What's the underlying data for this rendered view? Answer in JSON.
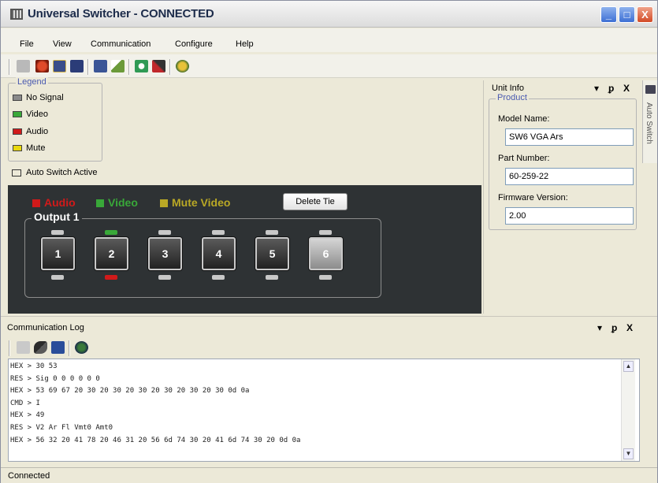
{
  "window": {
    "title": "Universal Switcher - CONNECTED",
    "min": "_",
    "max": "□",
    "close": "X"
  },
  "menu": [
    "File",
    "View",
    "Communication",
    "Configure",
    "Help"
  ],
  "toolbar_icons": [
    "disconnect-icon",
    "connect-icon",
    "view-matrix-icon",
    "view-list-icon",
    "display-icon",
    "edit-icon",
    "refresh-icon",
    "tools-icon",
    "help-icon"
  ],
  "legend": {
    "title": "Legend",
    "items": [
      {
        "label": "No Signal",
        "color": "#8a8a8a"
      },
      {
        "label": "Video",
        "color": "#39a839"
      },
      {
        "label": "Audio",
        "color": "#d11a1a"
      },
      {
        "label": "Mute",
        "color": "#e9d80c"
      }
    ]
  },
  "auto_switch": "Auto Switch Active",
  "tie_tags": {
    "audio": "Audio",
    "video": "Video",
    "mute": "Mute Video"
  },
  "tie_colors": {
    "audio": "#d11a1a",
    "video": "#39a839",
    "mute": "#b9a825"
  },
  "delete_tie": "Delete Tie",
  "output": {
    "title": "Output 1",
    "buttons": [
      {
        "label": "1",
        "top_led": "off",
        "bottom_led": "off",
        "selected": false
      },
      {
        "label": "2",
        "top_led": "video",
        "bottom_led": "audio",
        "selected": false
      },
      {
        "label": "3",
        "top_led": "off",
        "bottom_led": "off",
        "selected": false
      },
      {
        "label": "4",
        "top_led": "off",
        "bottom_led": "off",
        "selected": false
      },
      {
        "label": "5",
        "top_led": "off",
        "bottom_led": "off",
        "selected": false
      },
      {
        "label": "6",
        "top_led": "off",
        "bottom_led": "off",
        "selected": true
      }
    ]
  },
  "unit_info": {
    "header": "Unit Info",
    "controls": {
      "pin": "▾",
      "dock": "ᵱ",
      "close": "X"
    },
    "product": "Product",
    "fields": [
      {
        "label": "Model Name:",
        "value": "SW6 VGA Ars"
      },
      {
        "label": "Part Number:",
        "value": "60-259-22"
      },
      {
        "label": "Firmware Version:",
        "value": "2.00"
      }
    ]
  },
  "side_tab": "Auto Switch",
  "comm_log": {
    "title": "Communication Log",
    "controls": {
      "pin": "▾",
      "dock": "ᵱ",
      "close": "X"
    },
    "lines": [
      "HEX > 30 53",
      "RES > Sig 0 0 0 0 0 0",
      "HEX > 53 69 67 20 30 20 30 20 30 20 30 20 30 20 30 0d 0a",
      "CMD > I",
      "HEX > 49",
      "RES > V2 Ar Fl Vmt0 Amt0",
      "HEX > 56 32 20 41 78 20 46 31 20 56 6d 74 30 20 41 6d 74 30 20 0d 0a"
    ]
  },
  "status": "Connected"
}
